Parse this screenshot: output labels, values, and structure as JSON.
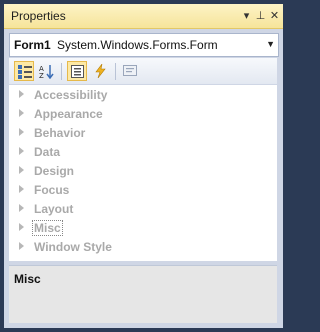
{
  "window": {
    "title": "Properties"
  },
  "title_buttons": [
    {
      "name": "dropdown-arrow-icon",
      "glyph": "▾"
    },
    {
      "name": "pin-icon",
      "glyph": "⊥"
    },
    {
      "name": "close-icon",
      "glyph": "✕"
    }
  ],
  "object_selector": {
    "name": "Form1",
    "type": "System.Windows.Forms.Form"
  },
  "toolbar": [
    {
      "name": "categorized-view-button",
      "icon": "categorized-icon",
      "active": true
    },
    {
      "name": "alphabetical-view-button",
      "icon": "alphabetical-az-icon",
      "active": false
    },
    {
      "name": "properties-view-button",
      "icon": "properties-list-icon",
      "active": true
    },
    {
      "name": "events-view-button",
      "icon": "lightning-bolt-icon",
      "active": false
    },
    {
      "name": "property-pages-button",
      "icon": "property-pages-icon",
      "active": false
    }
  ],
  "categories": [
    "Accessibility",
    "Appearance",
    "Behavior",
    "Data",
    "Design",
    "Focus",
    "Layout",
    "Misc",
    "Window Style"
  ],
  "selected_category": "Misc",
  "description": {
    "title": "Misc"
  },
  "colors": {
    "titlebar": "#f6e49a",
    "category_text": "#a9a9a9",
    "active_button": "#fde9a5"
  }
}
